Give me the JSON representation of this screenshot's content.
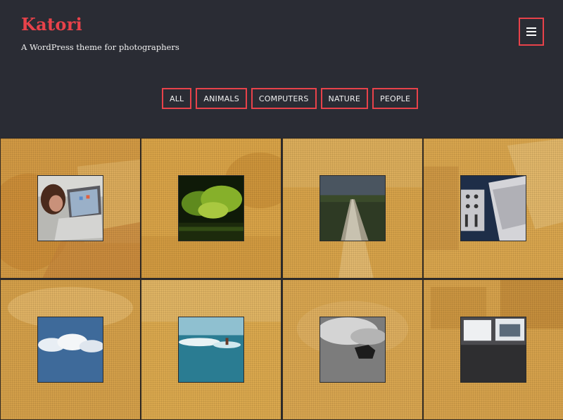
{
  "site": {
    "title": "Katori",
    "tagline": "A WordPress theme for photographers"
  },
  "header": {
    "menu_icon": "hamburger-menu-icon"
  },
  "filters": [
    {
      "label": "ALL"
    },
    {
      "label": "ANIMALS"
    },
    {
      "label": "COMPUTERS"
    },
    {
      "label": "NATURE"
    },
    {
      "label": "PEOPLE"
    }
  ],
  "colors": {
    "accent": "#e8424a",
    "header_bg": "#2a2c34",
    "tile_overlay": "#d9a24a"
  },
  "gallery": [
    {
      "subject": "laptop-with-person"
    },
    {
      "subject": "green-trees"
    },
    {
      "subject": "dirt-road-field"
    },
    {
      "subject": "laptop-and-audio-mixer"
    },
    {
      "subject": "cloudy-sky"
    },
    {
      "subject": "ocean-waves-person"
    },
    {
      "subject": "horse-black-and-white"
    },
    {
      "subject": "computer-monitors-desk"
    }
  ]
}
